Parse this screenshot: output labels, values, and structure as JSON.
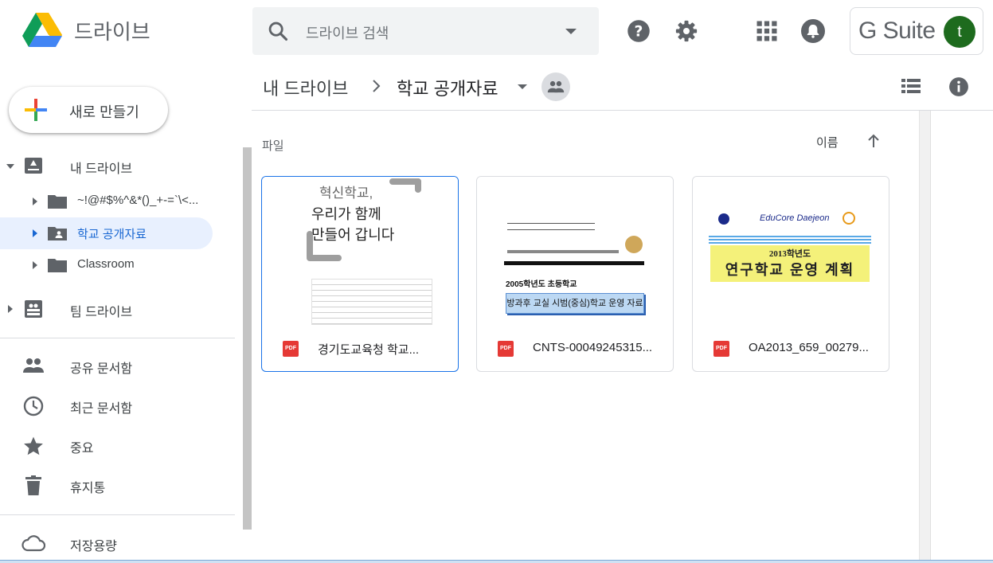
{
  "header": {
    "app_title": "드라이브",
    "search_placeholder": "드라이브 검색",
    "gsuite_label": "G Suite",
    "avatar_letter": "t"
  },
  "new_button": {
    "label": "새로 만들기"
  },
  "sidebar": {
    "my_drive": "내 드라이브",
    "folders": [
      {
        "label": "~!@#$%^&*()_+-=`\\<..."
      },
      {
        "label": "학교 공개자료"
      },
      {
        "label": "Classroom"
      }
    ],
    "team_drive": "팀 드라이브",
    "shared": "공유 문서함",
    "recent": "최근 문서함",
    "starred": "중요",
    "trash": "휴지통",
    "storage": "저장용량"
  },
  "breadcrumb": {
    "root": "내 드라이브",
    "current": "학교 공개자료"
  },
  "section": {
    "label": "파일",
    "sort_label": "이름"
  },
  "files": [
    {
      "name": "경기도교육청 학교...",
      "thumb_lines": [
        "혁신학교,",
        "우리가 함께",
        "만들어 갑니다"
      ]
    },
    {
      "name": "CNTS-00049245315...",
      "thumb_lines": [
        "2005학년도 초등학교",
        "방과후 교실 시범(중심)학교 운영 자료"
      ]
    },
    {
      "name": "OA2013_659_00279...",
      "thumb_lines": [
        "EduCore Daejeon",
        "2013학년도",
        "연구학교 운영 계획"
      ]
    }
  ],
  "colors": {
    "accent": "#1a73e8",
    "active_bg": "#e8f0fe",
    "pdf_red": "#e53935"
  }
}
